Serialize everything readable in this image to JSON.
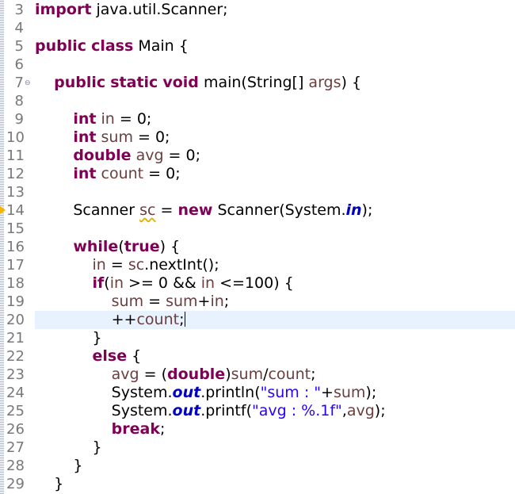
{
  "editor": {
    "lines": [
      {
        "n": "3",
        "tokens": [
          {
            "t": "import",
            "c": "kw"
          },
          {
            "t": " java.util.Scanner;"
          }
        ]
      },
      {
        "n": "4",
        "tokens": []
      },
      {
        "n": "5",
        "tokens": [
          {
            "t": "public",
            "c": "kw"
          },
          {
            "t": " "
          },
          {
            "t": "class",
            "c": "kw"
          },
          {
            "t": " Main {"
          }
        ]
      },
      {
        "n": "6",
        "tokens": []
      },
      {
        "n": "7",
        "fold": "⊖",
        "tokens": [
          {
            "t": "    "
          },
          {
            "t": "public",
            "c": "kw"
          },
          {
            "t": " "
          },
          {
            "t": "static",
            "c": "kw"
          },
          {
            "t": " "
          },
          {
            "t": "void",
            "c": "kw"
          },
          {
            "t": " main(String[] "
          },
          {
            "t": "args",
            "c": "var"
          },
          {
            "t": ") {"
          }
        ]
      },
      {
        "n": "8",
        "tokens": []
      },
      {
        "n": "9",
        "tokens": [
          {
            "t": "        "
          },
          {
            "t": "int",
            "c": "kw"
          },
          {
            "t": " "
          },
          {
            "t": "in",
            "c": "var"
          },
          {
            "t": " = 0;"
          }
        ]
      },
      {
        "n": "10",
        "tokens": [
          {
            "t": "        "
          },
          {
            "t": "int",
            "c": "kw"
          },
          {
            "t": " "
          },
          {
            "t": "sum",
            "c": "var"
          },
          {
            "t": " = 0;"
          }
        ]
      },
      {
        "n": "11",
        "tokens": [
          {
            "t": "        "
          },
          {
            "t": "double",
            "c": "kw"
          },
          {
            "t": " "
          },
          {
            "t": "avg",
            "c": "var"
          },
          {
            "t": " = 0;"
          }
        ]
      },
      {
        "n": "12",
        "tokens": [
          {
            "t": "        "
          },
          {
            "t": "int",
            "c": "kw"
          },
          {
            "t": " "
          },
          {
            "t": "count",
            "c": "var"
          },
          {
            "t": " = 0;"
          }
        ]
      },
      {
        "n": "13",
        "tokens": []
      },
      {
        "n": "14",
        "warn": true,
        "tokens": [
          {
            "t": "        Scanner "
          },
          {
            "t": "sc",
            "c": "var squig"
          },
          {
            "t": " = "
          },
          {
            "t": "new",
            "c": "kw"
          },
          {
            "t": " Scanner(System."
          },
          {
            "t": "in",
            "c": "fld"
          },
          {
            "t": ");"
          }
        ]
      },
      {
        "n": "15",
        "tokens": []
      },
      {
        "n": "16",
        "tokens": [
          {
            "t": "        "
          },
          {
            "t": "while",
            "c": "kw"
          },
          {
            "t": "("
          },
          {
            "t": "true",
            "c": "kw"
          },
          {
            "t": ") {"
          }
        ]
      },
      {
        "n": "17",
        "tokens": [
          {
            "t": "            "
          },
          {
            "t": "in",
            "c": "var"
          },
          {
            "t": " = "
          },
          {
            "t": "sc",
            "c": "var"
          },
          {
            "t": ".nextInt();"
          }
        ]
      },
      {
        "n": "18",
        "tokens": [
          {
            "t": "            "
          },
          {
            "t": "if",
            "c": "kw"
          },
          {
            "t": "("
          },
          {
            "t": "in",
            "c": "var"
          },
          {
            "t": " >= 0 && "
          },
          {
            "t": "in",
            "c": "var"
          },
          {
            "t": " <=100) {"
          }
        ]
      },
      {
        "n": "19",
        "tokens": [
          {
            "t": "                "
          },
          {
            "t": "sum",
            "c": "var"
          },
          {
            "t": " = "
          },
          {
            "t": "sum",
            "c": "var"
          },
          {
            "t": "+"
          },
          {
            "t": "in",
            "c": "var"
          },
          {
            "t": ";"
          }
        ]
      },
      {
        "n": "20",
        "current": true,
        "tokens": [
          {
            "t": "                ++"
          },
          {
            "t": "count",
            "c": "var"
          },
          {
            "t": ";"
          },
          {
            "t": "",
            "c": "caret"
          }
        ]
      },
      {
        "n": "21",
        "tokens": [
          {
            "t": "            }"
          }
        ]
      },
      {
        "n": "22",
        "tokens": [
          {
            "t": "            "
          },
          {
            "t": "else",
            "c": "kw"
          },
          {
            "t": " {"
          }
        ]
      },
      {
        "n": "23",
        "tokens": [
          {
            "t": "                "
          },
          {
            "t": "avg",
            "c": "var"
          },
          {
            "t": " = ("
          },
          {
            "t": "double",
            "c": "kw"
          },
          {
            "t": ")"
          },
          {
            "t": "sum",
            "c": "var"
          },
          {
            "t": "/"
          },
          {
            "t": "count",
            "c": "var"
          },
          {
            "t": ";"
          }
        ]
      },
      {
        "n": "24",
        "tokens": [
          {
            "t": "                System."
          },
          {
            "t": "out",
            "c": "fld"
          },
          {
            "t": ".println("
          },
          {
            "t": "\"sum : \"",
            "c": "str"
          },
          {
            "t": "+"
          },
          {
            "t": "sum",
            "c": "var"
          },
          {
            "t": ");"
          }
        ]
      },
      {
        "n": "25",
        "tokens": [
          {
            "t": "                System."
          },
          {
            "t": "out",
            "c": "fld"
          },
          {
            "t": ".printf("
          },
          {
            "t": "\"avg : %.1f\"",
            "c": "str"
          },
          {
            "t": ","
          },
          {
            "t": "avg",
            "c": "var"
          },
          {
            "t": ");"
          }
        ]
      },
      {
        "n": "26",
        "tokens": [
          {
            "t": "                "
          },
          {
            "t": "break",
            "c": "kw"
          },
          {
            "t": ";"
          }
        ]
      },
      {
        "n": "27",
        "tokens": [
          {
            "t": "            }"
          }
        ]
      },
      {
        "n": "28",
        "tokens": [
          {
            "t": "        }"
          }
        ]
      },
      {
        "n": "29",
        "tokens": [
          {
            "t": "    }"
          }
        ]
      }
    ]
  }
}
